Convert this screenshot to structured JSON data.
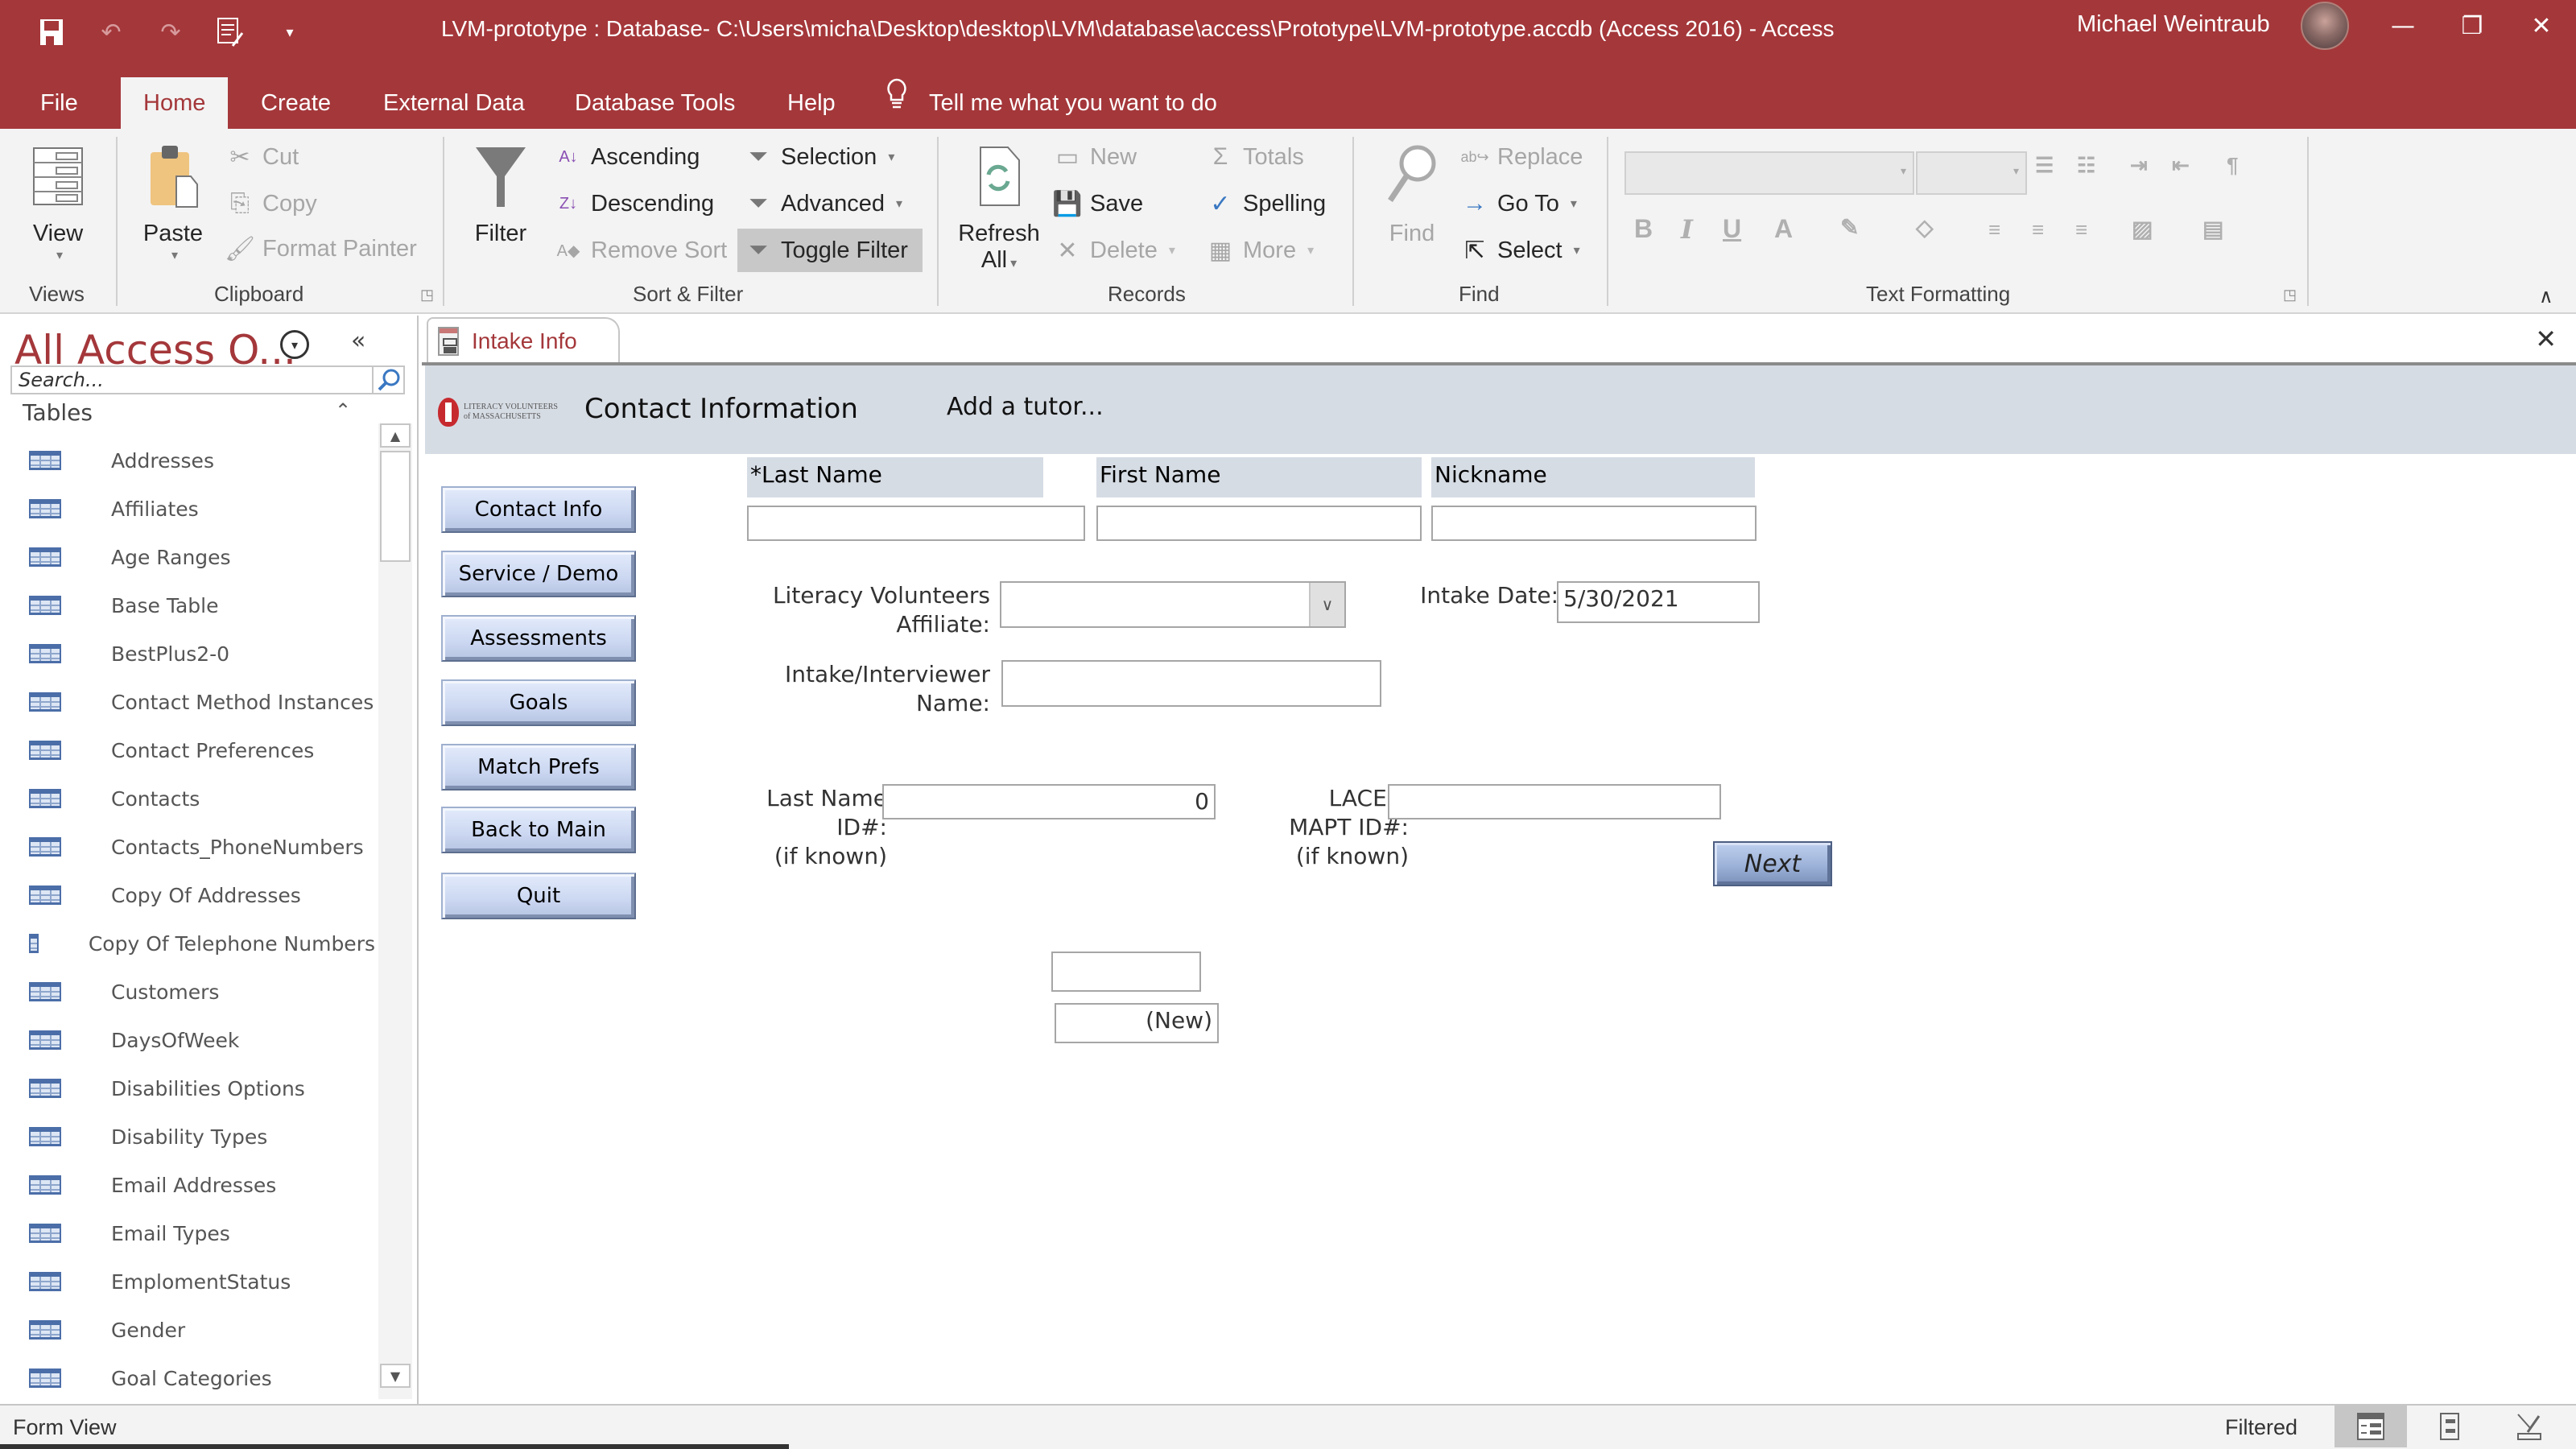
{
  "window": {
    "title": "LVM-prototype : Database- C:\\Users\\micha\\Desktop\\desktop\\LVM\\database\\access\\Prototype\\LVM-prototype.accdb (Access 2016)  -  Access",
    "user_name": "Michael Weintraub",
    "quick_access": [
      "save-icon",
      "undo-icon",
      "redo-icon",
      "form-view-icon",
      "customize-qat-icon"
    ]
  },
  "menu": {
    "tabs": [
      {
        "label": "File"
      },
      {
        "label": "Home",
        "active": true
      },
      {
        "label": "Create"
      },
      {
        "label": "External Data"
      },
      {
        "label": "Database Tools"
      },
      {
        "label": "Help"
      }
    ],
    "tell_me": "Tell me what you want to do"
  },
  "ribbon": {
    "views": {
      "label": "Views",
      "view": "View"
    },
    "clipboard": {
      "label": "Clipboard",
      "paste": "Paste",
      "cut": "Cut",
      "copy": "Copy",
      "format_painter": "Format Painter"
    },
    "sort_filter": {
      "label": "Sort & Filter",
      "filter": "Filter",
      "ascending": "Ascending",
      "descending": "Descending",
      "remove_sort": "Remove Sort",
      "selection": "Selection",
      "advanced": "Advanced",
      "toggle_filter": "Toggle Filter"
    },
    "records": {
      "label": "Records",
      "refresh": "Refresh",
      "refresh_all": "All",
      "new": "New",
      "save": "Save",
      "delete": "Delete",
      "totals": "Totals",
      "spelling": "Spelling",
      "more": "More"
    },
    "find": {
      "label": "Find",
      "find": "Find",
      "replace": "Replace",
      "goto": "Go To",
      "select": "Select"
    },
    "text_formatting": {
      "label": "Text Formatting",
      "bold": "B",
      "italic": "I",
      "underline": "U",
      "font_color": "A"
    }
  },
  "nav": {
    "title": "All Access O...",
    "search_placeholder": "Search...",
    "section": "Tables",
    "items": [
      "Addresses",
      "Affiliates",
      "Age Ranges",
      "Base Table",
      "BestPlus2-0",
      "Contact Method Instances",
      "Contact Preferences",
      "Contacts",
      "Contacts_PhoneNumbers",
      "Copy Of Addresses",
      "Copy Of Telephone Numbers",
      "Customers",
      "DaysOfWeek",
      "Disabilities Options",
      "Disability Types",
      "Email Addresses",
      "Email Types",
      "EmplomentStatus",
      "Gender",
      "Goal Categories"
    ]
  },
  "document": {
    "tab_label": "Intake Info",
    "logo_line1": "LITERACY VOLUNTEERS",
    "logo_line2": "of MASSACHUSETTS",
    "form_title": "Contact Information",
    "form_subtitle": "Add a tutor...",
    "side_buttons": [
      "Contact Info",
      "Service / Demo",
      "Assessments",
      "Goals",
      "Match Prefs",
      "Back to Main",
      "Quit"
    ],
    "columns": {
      "last_name": "*Last Name",
      "first_name": "First Name",
      "nickname": "Nickname"
    },
    "fields": {
      "last_name": "",
      "first_name": "",
      "nickname": "",
      "affiliate_label_1": "Literacy Volunteers",
      "affiliate_label_2": "Affiliate:",
      "affiliate_value": "",
      "intake_date_label": "Intake Date:",
      "intake_date": "5/30/2021",
      "interviewer_label_1": "Intake/Interviewer",
      "interviewer_label_2": "Name:",
      "interviewer_value": "",
      "lastname_id_label_1": "Last Name",
      "lastname_id_label_2": "ID#:",
      "lastname_id_label_3": "(if known)",
      "lastname_id_value": "0",
      "laces_label_1": "LACES/",
      "laces_label_2": "MAPT ID#:",
      "laces_label_3": "(if known)",
      "laces_value": "",
      "blank_box": "",
      "record_id": "(New)"
    },
    "next_button": "Next"
  },
  "status": {
    "view": "Form View",
    "filter": "Filtered"
  }
}
